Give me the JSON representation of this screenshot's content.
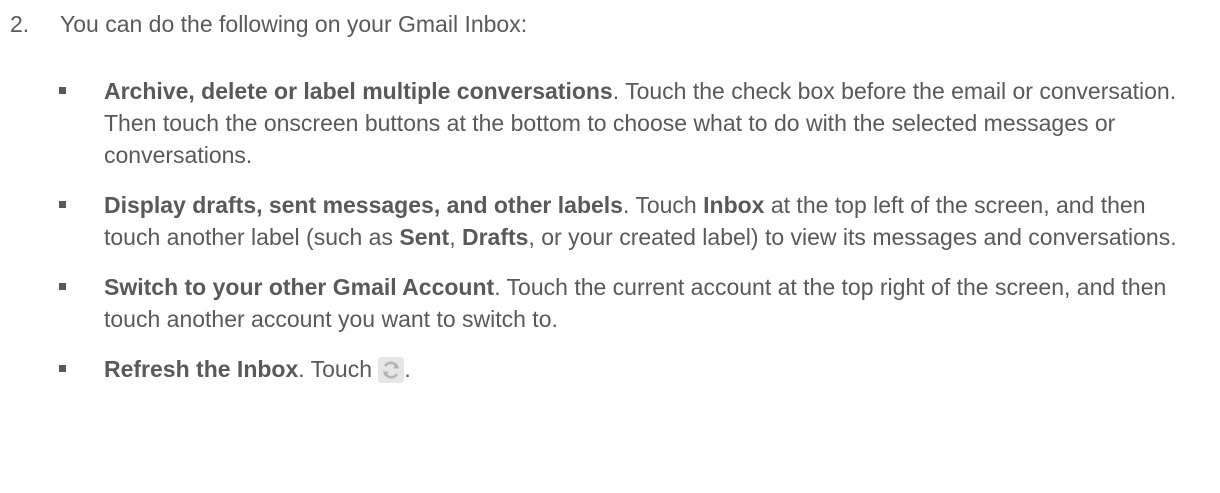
{
  "step": {
    "number": "2.",
    "text": "You can do the following on your Gmail Inbox:"
  },
  "bullets": [
    {
      "bold": "Archive, delete or label multiple conversations",
      "text": ". Touch the check box before the email or conversation. Then touch the onscreen buttons at the bottom to choose what to do with the selected messages or conversations."
    },
    {
      "bold": "Display drafts, sent messages, and other labels",
      "t1": ". Touch ",
      "b2": "Inbox",
      "t2": " at the top left of the screen, and then touch another label (such as ",
      "b3": "Sent",
      "t3": ", ",
      "b4": "Drafts",
      "t4": ", or your created label) to view its messages and conversations."
    },
    {
      "bold": "Switch to your other Gmail Account",
      "text": ". Touch the current account at the top right of the screen, and then touch another account you want to switch to."
    },
    {
      "bold": "Refresh the Inbox",
      "t1": ". Touch ",
      "t2": ".",
      "icon": "refresh-icon"
    }
  ],
  "colors": {
    "text": "#595959",
    "icon_bg": "#e6e6e6",
    "icon_fg": "#b5b5b5"
  }
}
